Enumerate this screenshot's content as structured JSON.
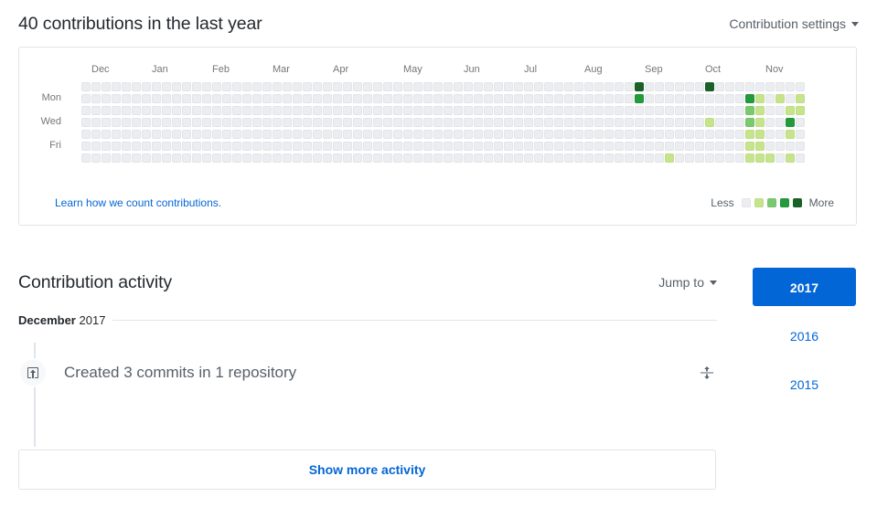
{
  "header": {
    "title": "40 contributions in the last year",
    "settings_label": "Contribution settings",
    "settings_caret_icon": "chevron-down-icon"
  },
  "graph": {
    "month_labels": [
      "Dec",
      "Jan",
      "Feb",
      "Mar",
      "Apr",
      "May",
      "Jun",
      "Jul",
      "Aug",
      "Sep",
      "Oct",
      "Nov"
    ],
    "day_labels": [
      "Mon",
      "Wed",
      "Fri"
    ],
    "learn_link": "Learn how we count contributions.",
    "legend": {
      "less_label": "Less",
      "more_label": "More",
      "colors": [
        "#ebedf0",
        "#c6e48b",
        "#7bc96f",
        "#239a3b",
        "#196127"
      ]
    },
    "columns": 53,
    "rows": 7,
    "empty_color": "#ebedf0"
  },
  "chart_data": {
    "type": "heatmap",
    "title": "40 contributions in the last year",
    "xlabel": "",
    "ylabel": "",
    "x_tick_labels": [
      "Dec",
      "Jan",
      "Feb",
      "Mar",
      "Apr",
      "May",
      "Jun",
      "Jul",
      "Aug",
      "Sep",
      "Oct",
      "Nov"
    ],
    "x_tick_columns": [
      1,
      6,
      10,
      15,
      20,
      24,
      29,
      34,
      38,
      43,
      48,
      52
    ],
    "y_tick_labels": [
      "Mon",
      "Wed",
      "Fri"
    ],
    "y_tick_rows": [
      1,
      3,
      5
    ],
    "levels": [
      0,
      1,
      2,
      3,
      4
    ],
    "level_colors": [
      "#ebedf0",
      "#c6e48b",
      "#7bc96f",
      "#239a3b",
      "#196127"
    ],
    "total_contributions": 40,
    "grid_columns": 53,
    "grid_rows": 7,
    "cells": [
      {
        "col": 55,
        "row": 0,
        "level": 4
      },
      {
        "col": 55,
        "row": 1,
        "level": 3
      },
      {
        "col": 62,
        "row": 0,
        "level": 4
      },
      {
        "col": 62,
        "row": 3,
        "level": 1
      },
      {
        "col": 58,
        "row": 6,
        "level": 1
      },
      {
        "col": 66,
        "row": 1,
        "level": 3
      },
      {
        "col": 66,
        "row": 2,
        "level": 2
      },
      {
        "col": 66,
        "row": 3,
        "level": 2
      },
      {
        "col": 66,
        "row": 4,
        "level": 1
      },
      {
        "col": 66,
        "row": 5,
        "level": 1
      },
      {
        "col": 66,
        "row": 6,
        "level": 1
      },
      {
        "col": 67,
        "row": 1,
        "level": 1
      },
      {
        "col": 67,
        "row": 2,
        "level": 1
      },
      {
        "col": 67,
        "row": 3,
        "level": 1
      },
      {
        "col": 67,
        "row": 4,
        "level": 1
      },
      {
        "col": 67,
        "row": 5,
        "level": 1
      },
      {
        "col": 67,
        "row": 6,
        "level": 1
      },
      {
        "col": 68,
        "row": 6,
        "level": 1
      },
      {
        "col": 69,
        "row": 1,
        "level": 1
      },
      {
        "col": 70,
        "row": 2,
        "level": 1
      },
      {
        "col": 70,
        "row": 3,
        "level": 3
      },
      {
        "col": 70,
        "row": 4,
        "level": 1
      },
      {
        "col": 70,
        "row": 6,
        "level": 1
      },
      {
        "col": 71,
        "row": 1,
        "level": 1
      },
      {
        "col": 71,
        "row": 2,
        "level": 1
      }
    ]
  },
  "activity": {
    "title": "Contribution activity",
    "jump_to_label": "Jump to",
    "jump_to_caret_icon": "chevron-down-icon",
    "month_heading_month": "December",
    "month_heading_year": "2017",
    "rows": [
      {
        "icon": "repo-push-icon",
        "text": "Created 3 commits in 1 repository",
        "toggle_icon": "fold-icon"
      }
    ],
    "show_more_label": "Show more activity"
  },
  "years": [
    {
      "label": "2017",
      "selected": true
    },
    {
      "label": "2016",
      "selected": false
    },
    {
      "label": "2015",
      "selected": false
    }
  ]
}
